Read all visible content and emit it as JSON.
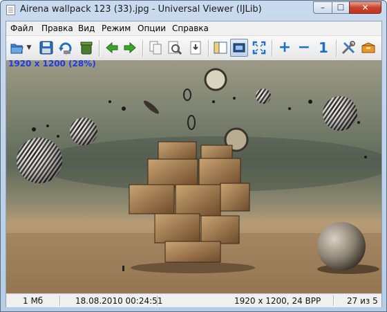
{
  "window": {
    "title": "Airena wallpack 123 (33).jpg - Universal Viewer (IJLib)"
  },
  "titlebar": {
    "minimize": "–",
    "maximize": "☐",
    "close": "✕"
  },
  "menu": [
    "Файл",
    "Правка",
    "Вид",
    "Режим",
    "Опции",
    "Справка"
  ],
  "toolbar": {
    "buttons": [
      {
        "name": "open",
        "icon": "folder-open-icon"
      },
      {
        "name": "open-dropdown",
        "icon": "chevron-down-icon"
      },
      {
        "name": "save",
        "icon": "floppy-disk-icon"
      },
      {
        "name": "reload",
        "icon": "reload-icon"
      },
      {
        "name": "delete",
        "icon": "trash-can-icon"
      },
      {
        "name": "back",
        "icon": "arrow-left-icon"
      },
      {
        "name": "forward",
        "icon": "arrow-right-icon"
      },
      {
        "name": "copy",
        "icon": "copy-icon"
      },
      {
        "name": "find",
        "icon": "find-icon"
      },
      {
        "name": "goto",
        "icon": "goto-page-icon"
      },
      {
        "name": "panel",
        "icon": "panel-icon"
      },
      {
        "name": "fit-window",
        "icon": "fit-window-icon"
      },
      {
        "name": "fullscreen",
        "icon": "fullscreen-icon"
      },
      {
        "name": "zoom-in",
        "icon": "plus-icon",
        "label": "+"
      },
      {
        "name": "zoom-out",
        "icon": "minus-icon",
        "label": "−"
      },
      {
        "name": "original-size",
        "icon": "one-to-one-icon",
        "label": "1"
      },
      {
        "name": "options",
        "icon": "tools-icon"
      },
      {
        "name": "plugins",
        "icon": "box-icon"
      }
    ],
    "accent": "#1e6fc8",
    "nav_green": "#3aa52a"
  },
  "image": {
    "info": "1920 x 1200 (28%)"
  },
  "status": {
    "size": "1 Mб",
    "datetime": "18.08.2010 00:24:51",
    "dimensions": "1920 x 1200, 24 BPP",
    "position": "27 из 5"
  }
}
